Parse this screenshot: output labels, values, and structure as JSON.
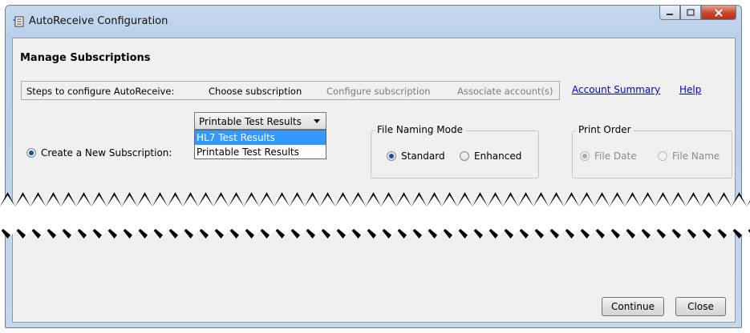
{
  "window": {
    "title": "AutoReceive Configuration"
  },
  "page": {
    "title": "Manage Subscriptions"
  },
  "steps": {
    "intro": "Steps to configure AutoReceive:",
    "items": [
      {
        "label": "Choose subscription",
        "state": "active"
      },
      {
        "label": "Configure subscription",
        "state": "inactive"
      },
      {
        "label": "Associate account(s)",
        "state": "inactive"
      }
    ]
  },
  "links": {
    "account_summary": "Account Summary",
    "help": "Help"
  },
  "create": {
    "radio_label": "Create a New Subscription:",
    "selected_value": "Printable Test Results",
    "options": [
      {
        "label": "HL7 Test Results",
        "highlighted": true
      },
      {
        "label": "Printable Test Results",
        "highlighted": false
      }
    ]
  },
  "file_naming": {
    "legend": "File Naming Mode",
    "options": [
      {
        "label": "Standard",
        "checked": true
      },
      {
        "label": "Enhanced",
        "checked": false
      }
    ]
  },
  "print_order": {
    "legend": "Print Order",
    "enabled": false,
    "options": [
      {
        "label": "File Date",
        "checked": true
      },
      {
        "label": "File Name",
        "checked": false
      }
    ]
  },
  "buttons": {
    "continue": "Continue",
    "close": "Close"
  },
  "colors": {
    "link": "#0000cc",
    "highlight": "#3399ff",
    "close_button": "#c9432c"
  }
}
